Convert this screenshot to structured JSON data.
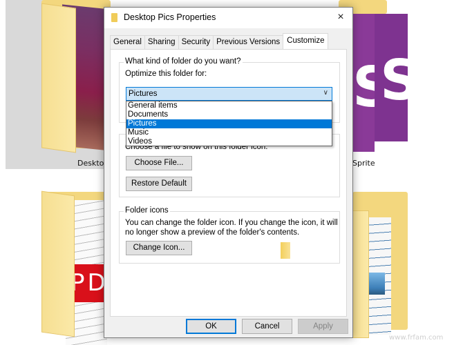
{
  "background": {
    "folders": [
      {
        "label": "Desktop Pics",
        "visible_label": "Desktop"
      },
      {
        "label": "Sprite",
        "visible_label": "Sprite"
      },
      {
        "label": "",
        "content": "PDF"
      },
      {
        "label": "",
        "content": "documents"
      }
    ],
    "watermark": "www.frfam.com"
  },
  "dialog": {
    "title": "Desktop Pics Properties",
    "close_icon": "×",
    "tabs": [
      {
        "label": "General",
        "active": false
      },
      {
        "label": "Sharing",
        "active": false
      },
      {
        "label": "Security",
        "active": false
      },
      {
        "label": "Previous Versions",
        "active": false
      },
      {
        "label": "Customize",
        "active": true
      }
    ],
    "folder_type_group": {
      "title": "What kind of folder do you want?",
      "optimize_label": "Optimize this folder for:",
      "selected": "Pictures",
      "options": [
        "General items",
        "Documents",
        "Pictures",
        "Music",
        "Videos"
      ]
    },
    "folder_pictures_group": {
      "description": "Choose a file to show on this folder icon.",
      "choose_file_label": "Choose File...",
      "restore_default_label": "Restore Default"
    },
    "folder_icons_group": {
      "title": "Folder icons",
      "description_line1": "You can change the folder icon. If you change the icon, it will",
      "description_line2": "no longer show a preview of the folder's contents.",
      "change_icon_label": "Change Icon..."
    },
    "footer": {
      "ok_label": "OK",
      "cancel_label": "Cancel",
      "apply_label": "Apply"
    }
  }
}
